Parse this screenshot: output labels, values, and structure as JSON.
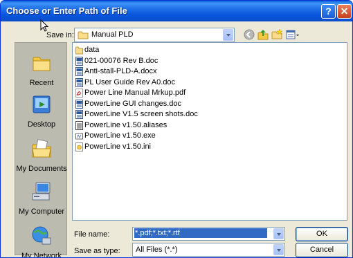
{
  "title": "Choose or Enter Path of File",
  "title_buttons": {
    "help": "?",
    "close": "✕"
  },
  "save_in": {
    "label": "Save in:",
    "value": "Manual PLD"
  },
  "toolbar": [
    {
      "name": "back-icon"
    },
    {
      "name": "up-folder-icon"
    },
    {
      "name": "new-folder-icon"
    },
    {
      "name": "views-menu-icon"
    }
  ],
  "places": [
    {
      "label": "Recent",
      "icon": "recent-icon"
    },
    {
      "label": "Desktop",
      "icon": "desktop-icon"
    },
    {
      "label": "My Documents",
      "icon": "my-documents-icon"
    },
    {
      "label": "My Computer",
      "icon": "my-computer-icon"
    },
    {
      "label": "My Network",
      "icon": "my-network-icon"
    }
  ],
  "files": [
    {
      "name": "data",
      "icon": "folder-icon"
    },
    {
      "name": "021-00076 Rev B.doc",
      "icon": "word-doc-icon"
    },
    {
      "name": "Anti-stall-PLD-A.docx",
      "icon": "word-doc-icon"
    },
    {
      "name": "PL User Guide Rev A0.doc",
      "icon": "word-doc-icon"
    },
    {
      "name": "Power Line Manual Mrkup.pdf",
      "icon": "pdf-icon"
    },
    {
      "name": "PowerLine GUI changes.doc",
      "icon": "word-doc-icon"
    },
    {
      "name": "PowerLine V1.5 screen shots.doc",
      "icon": "word-doc-icon"
    },
    {
      "name": "PowerLine v1.50.aliases",
      "icon": "file-icon"
    },
    {
      "name": "PowerLine v1.50.exe",
      "icon": "exe-icon"
    },
    {
      "name": "PowerLine v1.50.ini",
      "icon": "ini-icon"
    }
  ],
  "file_name": {
    "label": "File name:",
    "value": "*.pdf;*.txt;*.rtf"
  },
  "save_type": {
    "label": "Save as type:",
    "value": "All Files (*.*)"
  },
  "buttons": {
    "ok": "OK",
    "cancel": "Cancel"
  },
  "colors": {
    "titlebar": "#0a5fd8",
    "dialog_bg": "#ece9d8",
    "selection": "#316ac5"
  }
}
